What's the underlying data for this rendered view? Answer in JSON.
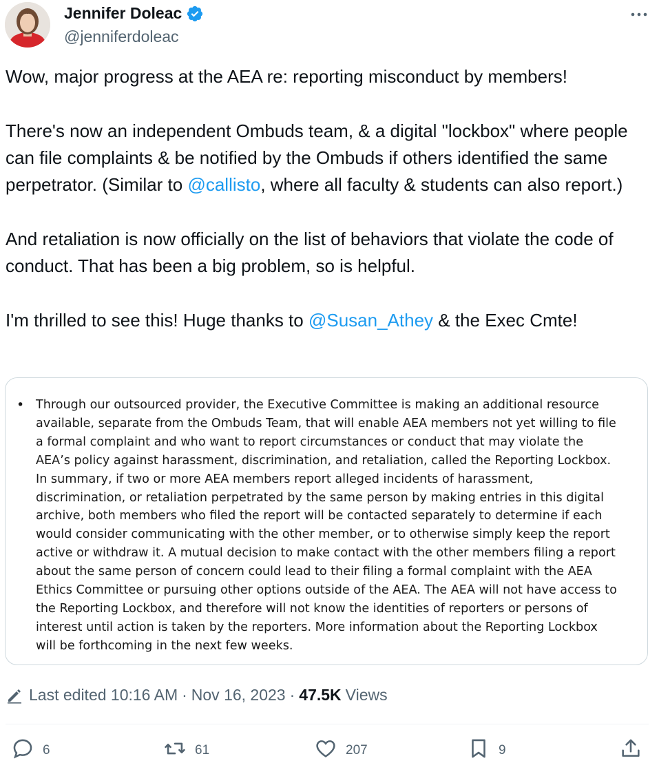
{
  "author": {
    "name": "Jennifer Doleac",
    "handle": "@jenniferdoleac"
  },
  "tweet": {
    "p1": "Wow, major progress at the AEA re: reporting misconduct by members!",
    "p2_a": "There's now an independent Ombuds team, & a digital \"lockbox\" where people can file complaints & be notified by the Ombuds if others identified the same perpetrator. (Similar to ",
    "p2_mention": "@callisto",
    "p2_b": ", where all faculty & students can also report.)",
    "p3": "And retaliation is now officially on the list of behaviors that violate the code of conduct. That has been a big problem, so is helpful.",
    "p4_a": "I'm thrilled to see this! Huge thanks to ",
    "p4_mention": "@Susan_Athey",
    "p4_b": " & the Exec Cmte!"
  },
  "media": {
    "bullet": "•",
    "text": "Through our outsourced provider, the Executive Committee is making an additional resource\navailable, separate from the Ombuds Team, that will enable AEA members not yet willing to file\na formal complaint and who want to report circumstances or conduct that may violate the\nAEA’s policy against harassment, discrimination, and retaliation, called the Reporting Lockbox.\nIn summary, if two or more AEA members report alleged incidents of harassment,\ndiscrimination, or retaliation perpetrated by the same person by making entries in this digital\narchive, both members who filed the report will be contacted separately to determine if each\nwould consider communicating with the other member, or to otherwise simply keep the report\nactive or withdraw it. A mutual decision to make contact with the other members filing a report\nabout the same person of concern could lead to their filing a formal complaint with the AEA\nEthics Committee or pursuing other options outside of the AEA. The AEA will not have access to\nthe Reporting Lockbox, and therefore will not know the identities of reporters or persons of\ninterest until action is taken by the reporters. More information about the Reporting Lockbox\nwill be forthcoming in the next few weeks."
  },
  "meta": {
    "edited": "Last edited 10:16 AM",
    "sep1": "·",
    "date": "Nov 16, 2023",
    "sep2": "·",
    "views_count": "47.5K",
    "views_label": "Views"
  },
  "actions": {
    "replies": "6",
    "reposts": "61",
    "likes": "207",
    "bookmarks": "9"
  },
  "colors": {
    "accent": "#1d9bf0",
    "text": "#0f1419",
    "secondary": "#536471"
  },
  "icons": [
    "verified-badge-icon",
    "more-icon",
    "pencil-icon",
    "reply-icon",
    "repost-icon",
    "like-icon",
    "bookmark-icon",
    "share-icon"
  ]
}
